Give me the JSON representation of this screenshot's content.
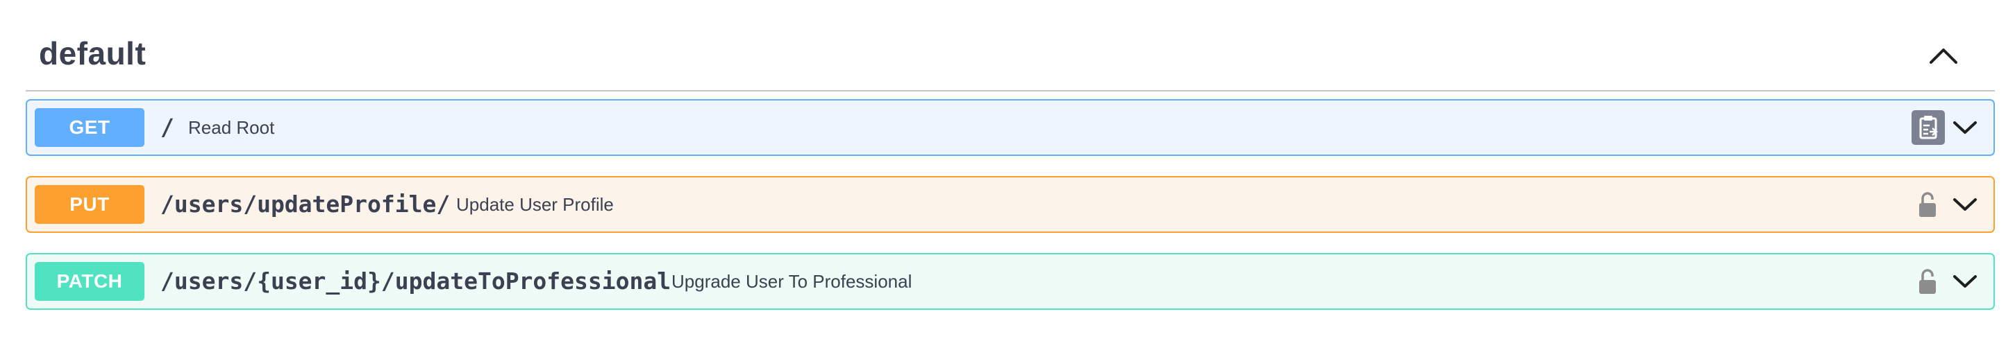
{
  "section": {
    "title": "default",
    "collapse_icon": "chevron-up-icon"
  },
  "operations": [
    {
      "method": "GET",
      "path": "/",
      "summary": "Read Root",
      "color": "#61affe",
      "action_icon": "copy-to-clipboard-icon"
    },
    {
      "method": "PUT",
      "path": "/users/updateProfile/",
      "summary": "Update User Profile",
      "color": "#fca130",
      "action_icon": "unlocked-icon"
    },
    {
      "method": "PATCH",
      "path": "/users/{user_id}/updateToProfessional",
      "summary": "Upgrade User To Professional",
      "color": "#50e3c2",
      "action_icon": "unlocked-icon"
    }
  ],
  "expand_icon": "chevron-down-icon"
}
